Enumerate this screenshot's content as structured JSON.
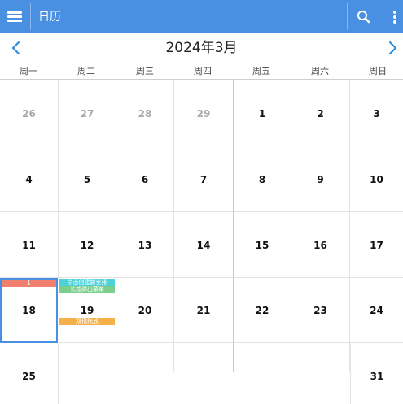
{
  "app": {
    "title": "日历",
    "accent": "#4a90e2"
  },
  "toolbar": {
    "menu_icon": "menu-icon",
    "search_icon": "search-icon",
    "more_icon": "more-vert-icon"
  },
  "calendar": {
    "month_title": "2024年3月",
    "weekdays": [
      "周一",
      "周二",
      "周三",
      "周四",
      "周五",
      "周六",
      "周日"
    ],
    "weeks": [
      [
        "26",
        "27",
        "28",
        "29",
        "1",
        "2",
        "3"
      ],
      [
        "4",
        "5",
        "6",
        "7",
        "8",
        "9",
        "10"
      ],
      [
        "11",
        "12",
        "13",
        "14",
        "15",
        "16",
        "17"
      ],
      [
        "18",
        "19",
        "20",
        "21",
        "22",
        "23",
        "24"
      ],
      [
        "25",
        "",
        "",
        "",
        "",
        "",
        "31"
      ]
    ],
    "today_marker": "1",
    "events": [
      {
        "text": "点击创建新安排",
        "color": "#4fd1d9"
      },
      {
        "text": "长按弹出菜单",
        "color": "#7ccf8a"
      },
      {
        "text": "双指拖放",
        "color": "#f5b04a"
      }
    ]
  }
}
